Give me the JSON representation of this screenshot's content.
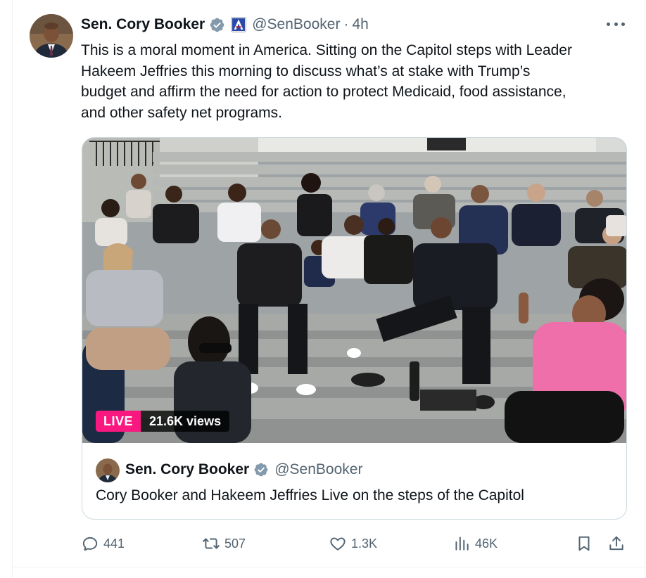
{
  "author": {
    "name": "Sen. Cory Booker",
    "handle": "@SenBooker",
    "separator": "·",
    "time": "4h"
  },
  "tweet": {
    "text_lines": [
      "This is a moral moment in America. Sitting on the Capitol steps with Leader",
      "Hakeem Jeffries this morning to discuss what’s at stake with Trump’s",
      "budget and affirm the need for action to protect Medicaid, food assistance,",
      "and other safety net programs."
    ]
  },
  "media": {
    "live_label": "LIVE",
    "views": "21.6K views"
  },
  "card": {
    "name": "Sen. Cory Booker",
    "handle": "@SenBooker",
    "title": "Cory Booker and Hakeem Jeffries Live on the steps of the Capitol"
  },
  "actions": {
    "replies": "441",
    "reposts": "507",
    "likes": "1.3K",
    "views": "46K"
  },
  "icons": {
    "verified": "verified-badge-icon",
    "affiliation": "us-senate-affiliation-icon",
    "more": "more-dots-icon",
    "reply": "reply-icon",
    "repost": "repost-icon",
    "like": "heart-icon",
    "views": "analytics-icon",
    "bookmark": "bookmark-icon",
    "share": "share-icon"
  },
  "colors": {
    "text": "#0f1419",
    "secondary": "#536471",
    "verified": "#829aab",
    "live": "#f91880",
    "border": "#cfd9de"
  }
}
